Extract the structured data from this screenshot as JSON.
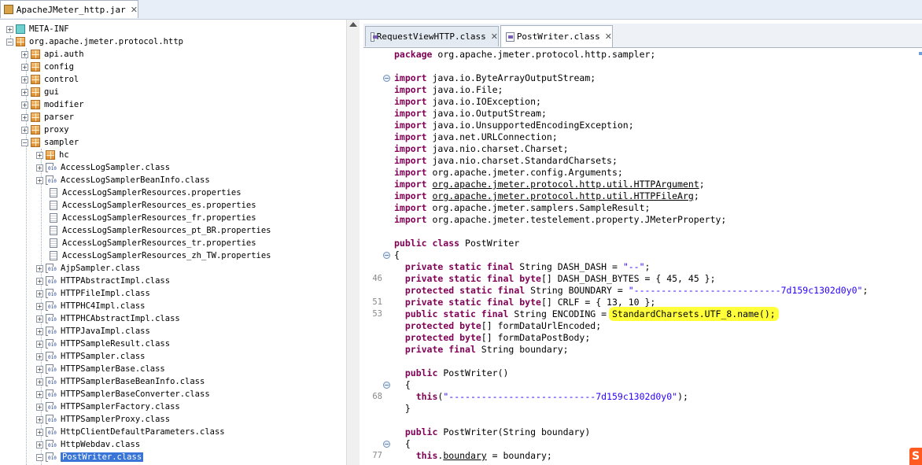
{
  "archive_tab": {
    "label": "ApacheJMeter_http.jar",
    "close": "✕"
  },
  "tree": {
    "root_nodes": [
      {
        "label": "META-INF"
      },
      {
        "label": "org.apache.jmeter.protocol.http"
      }
    ],
    "packages": [
      "api.auth",
      "config",
      "control",
      "gui",
      "modifier",
      "parser",
      "proxy",
      "sampler"
    ],
    "sub_package": "hc",
    "files": [
      "AccessLogSampler.class",
      "AccessLogSamplerBeanInfo.class",
      "AccessLogSamplerResources.properties",
      "AccessLogSamplerResources_es.properties",
      "AccessLogSamplerResources_fr.properties",
      "AccessLogSamplerResources_pt_BR.properties",
      "AccessLogSamplerResources_tr.properties",
      "AccessLogSamplerResources_zh_TW.properties",
      "AjpSampler.class",
      "HTTPAbstractImpl.class",
      "HTTPFileImpl.class",
      "HTTPHC4Impl.class",
      "HTTPHCAbstractImpl.class",
      "HTTPJavaImpl.class",
      "HTTPSampleResult.class",
      "HTTPSampler.class",
      "HTTPSamplerBase.class",
      "HTTPSamplerBaseBeanInfo.class",
      "HTTPSamplerBaseConverter.class",
      "HTTPSamplerFactory.class",
      "HTTPSamplerProxy.class",
      "HttpClientDefaultParameters.class",
      "HttpWebdav.class",
      "PostWriter.class"
    ],
    "selected": "PostWriter.class"
  },
  "editor": {
    "tabs": [
      {
        "label": "RequestViewHTTP.class",
        "close": "✕"
      },
      {
        "label": "PostWriter.class",
        "close": "✕"
      }
    ],
    "line_numbers": {
      "dash_bytes": "46",
      "crlf": "51",
      "encoding": "53",
      "ctor_call": "68",
      "boundary_assign": "77"
    }
  },
  "colors": {
    "keyword": "#7f0055",
    "string": "#2a00ff",
    "highlight": "#ffff3a",
    "selection": "#3875d7"
  }
}
